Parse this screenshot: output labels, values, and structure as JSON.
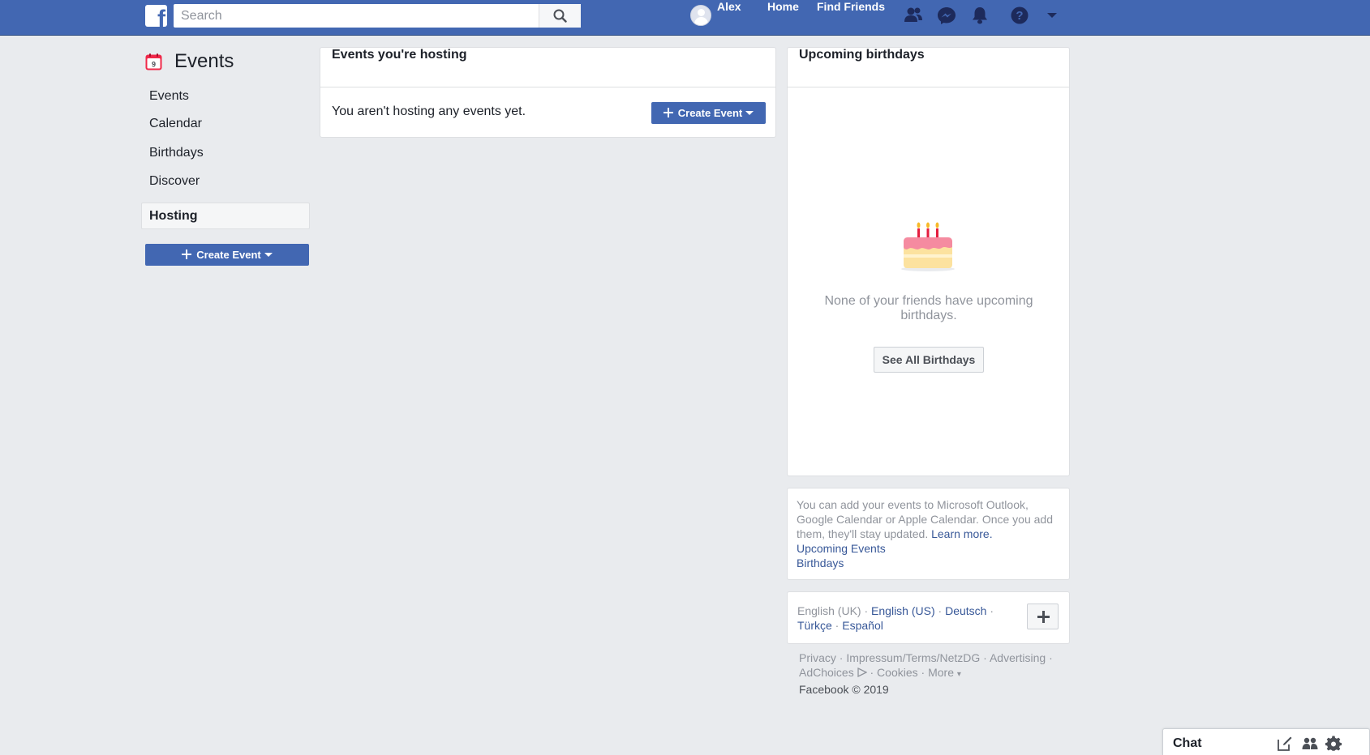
{
  "topbar": {
    "logo_letter": "f",
    "search_placeholder": "Search",
    "user_name": "Alex",
    "home_label": "Home",
    "find_friends_label": "Find Friends",
    "icons": [
      "friend-requests-icon",
      "messenger-icon",
      "notifications-icon",
      "help-icon",
      "account-menu-caret-icon"
    ],
    "bar_color": "#4267b2"
  },
  "sidebar": {
    "title": "Events",
    "calendar_icon_day": "9",
    "items": [
      {
        "label": "Events",
        "active": false
      },
      {
        "label": "Calendar",
        "active": false
      },
      {
        "label": "Birthdays",
        "active": false
      },
      {
        "label": "Discover",
        "active": false
      },
      {
        "label": "Hosting",
        "active": true
      }
    ],
    "create_button_label": "Create Event"
  },
  "hosting_card": {
    "title": "Events you're hosting",
    "empty_message": "You aren't hosting any events yet.",
    "create_button_label": "Create Event"
  },
  "birthdays_card": {
    "title": "Upcoming birthdays",
    "empty_message": "None of your friends have upcoming birthdays.",
    "see_all_label": "See All Birthdays"
  },
  "export_card": {
    "text": "You can add your events to Microsoft Outlook, Google Calendar or Apple Calendar. Once you add them, they'll stay updated.",
    "learn_more": "Learn more.",
    "links": [
      "Upcoming Events",
      "Birthdays"
    ]
  },
  "languages": {
    "current": "English (UK)",
    "others": [
      "English (US)",
      "Deutsch",
      "Türkçe",
      "Español"
    ],
    "separator": " · "
  },
  "footer": {
    "links": [
      "Privacy",
      "Impressum/Terms/NetzDG",
      "Advertising",
      "AdChoices",
      "Cookies",
      "More"
    ],
    "copyright": "Facebook © 2019"
  },
  "chat": {
    "label": "Chat",
    "icons": [
      "new-message-icon",
      "create-group-icon",
      "settings-gear-icon"
    ]
  }
}
